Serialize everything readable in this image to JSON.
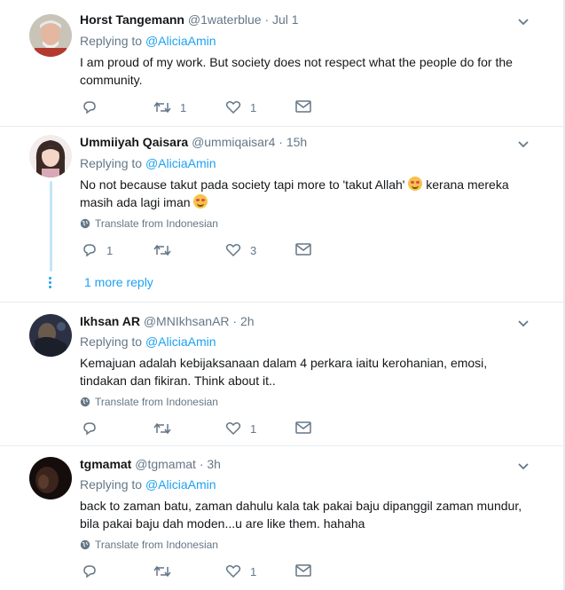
{
  "colors": {
    "link": "#1da1f2",
    "muted": "#657786",
    "text": "#14171a",
    "thread_line": "#c4e5f9"
  },
  "replying_prefix": "Replying to",
  "tweets": [
    {
      "name": "Horst Tangemann",
      "meta": "@1waterblue · Jul 1",
      "reply_to": "@AliciaAmin",
      "text": "I am proud of my work. But society does not respect what the people do for the community.",
      "replies": "",
      "retweets": "1",
      "likes": "1"
    },
    {
      "name": "Ummiiyah Qaisara",
      "meta": "@ummiqaisar4 · 15h",
      "reply_to": "@AliciaAmin",
      "text_a": "No not because takut pada society tapi more to 'takut Allah'",
      "text_b": "kerana mereka masih ada lagi iman",
      "translate": "Translate from Indonesian",
      "replies": "1",
      "retweets": "",
      "likes": "3",
      "more_reply": "1 more reply"
    },
    {
      "name": "Ikhsan AR",
      "meta": "@MNIkhsanAR · 2h",
      "reply_to": "@AliciaAmin",
      "text": "Kemajuan adalah kebijaksanaan dalam 4 perkara iaitu kerohanian, emosi, tindakan dan fikiran. Think about it..",
      "translate": "Translate from Indonesian",
      "replies": "",
      "retweets": "",
      "likes": "1"
    },
    {
      "name": "tgmamat",
      "meta": "@tgmamat · 3h",
      "reply_to": "@AliciaAmin",
      "text": "back to zaman batu, zaman dahulu kala tak pakai baju dipanggil zaman mundur, bila pakai baju dah moden...u are like them. hahaha",
      "translate": "Translate from Indonesian",
      "replies": "",
      "retweets": "",
      "likes": "1"
    }
  ]
}
